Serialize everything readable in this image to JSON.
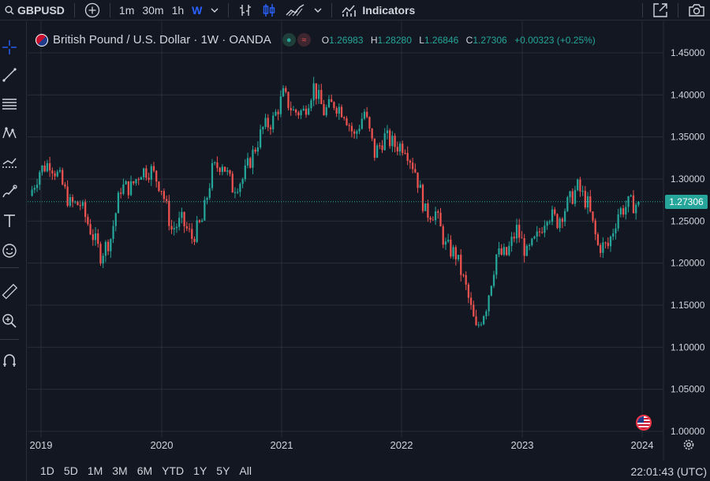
{
  "toolbar": {
    "symbol": "GBPUSD",
    "timeframes": [
      "1m",
      "30m",
      "1h",
      "W"
    ],
    "active_timeframe": "W",
    "indicators_label": "Indicators",
    "icons": [
      "search-icon",
      "add-symbol-icon",
      "chevron-down-icon",
      "bar-style-icon",
      "candle-style-icon",
      "area-style-icon",
      "indicators-icon",
      "fullscreen-icon",
      "camera-icon"
    ]
  },
  "left_tools": [
    "crosshair-icon",
    "trendline-icon",
    "fib-icon",
    "pattern-icon",
    "forecast-icon",
    "brush-icon",
    "text-icon",
    "emoji-icon",
    "ruler-icon",
    "zoom-in-icon",
    "magnet-icon"
  ],
  "legend": {
    "title": "British Pound / U.S. Dollar · 1W · OANDA",
    "o_label": "O",
    "o_value": "1.26983",
    "h_label": "H",
    "h_value": "1.28280",
    "l_label": "L",
    "l_value": "1.26846",
    "c_label": "C",
    "c_value": "1.27306",
    "change": "+0.00323 (+0.25%)"
  },
  "price_axis": {
    "ticks": [
      "1.45000",
      "1.40000",
      "1.35000",
      "1.30000",
      "1.25000",
      "1.20000",
      "1.15000",
      "1.10000",
      "1.05000",
      "1.00000"
    ],
    "last_price": "1.27306"
  },
  "time_axis": {
    "ticks": [
      "2019",
      "2020",
      "2021",
      "2022",
      "2023",
      "2024"
    ]
  },
  "ranges": [
    "1D",
    "5D",
    "1M",
    "3M",
    "6M",
    "YTD",
    "1Y",
    "5Y",
    "All"
  ],
  "clock": "22:01:43 (UTC)",
  "colors": {
    "up": "#26a69a",
    "down": "#ef5350",
    "bg": "#131722",
    "grid": "#2a2e39",
    "accent": "#2962ff"
  },
  "chart_data": {
    "type": "candlestick",
    "symbol": "GBPUSD",
    "interval": "1W",
    "ylim": [
      1.0,
      1.45
    ],
    "x": [
      "2019-01",
      "2019-02",
      "2019-03",
      "2019-04",
      "2019-05",
      "2019-06",
      "2019-07",
      "2019-08",
      "2019-09",
      "2019-10",
      "2019-11",
      "2019-12",
      "2020-01",
      "2020-02",
      "2020-03",
      "2020-04",
      "2020-05",
      "2020-06",
      "2020-07",
      "2020-08",
      "2020-09",
      "2020-10",
      "2020-11",
      "2020-12",
      "2021-01",
      "2021-02",
      "2021-03",
      "2021-04",
      "2021-05",
      "2021-06",
      "2021-07",
      "2021-08",
      "2021-09",
      "2021-10",
      "2021-11",
      "2021-12",
      "2022-01",
      "2022-02",
      "2022-03",
      "2022-04",
      "2022-05",
      "2022-06",
      "2022-07",
      "2022-08",
      "2022-09",
      "2022-10",
      "2022-11",
      "2022-12",
      "2023-01",
      "2023-02",
      "2023-03",
      "2023-04",
      "2023-05",
      "2023-06",
      "2023-07",
      "2023-08",
      "2023-09",
      "2023-10",
      "2023-11",
      "2023-12"
    ],
    "close": [
      1.28,
      1.31,
      1.32,
      1.3,
      1.27,
      1.27,
      1.24,
      1.21,
      1.23,
      1.29,
      1.29,
      1.31,
      1.31,
      1.29,
      1.24,
      1.25,
      1.23,
      1.25,
      1.31,
      1.32,
      1.29,
      1.3,
      1.33,
      1.36,
      1.37,
      1.4,
      1.38,
      1.38,
      1.41,
      1.38,
      1.39,
      1.38,
      1.35,
      1.38,
      1.33,
      1.35,
      1.34,
      1.34,
      1.31,
      1.26,
      1.26,
      1.22,
      1.21,
      1.17,
      1.12,
      1.15,
      1.21,
      1.21,
      1.24,
      1.21,
      1.23,
      1.26,
      1.25,
      1.27,
      1.29,
      1.27,
      1.22,
      1.22,
      1.26,
      1.27
    ],
    "last": 1.27306
  }
}
